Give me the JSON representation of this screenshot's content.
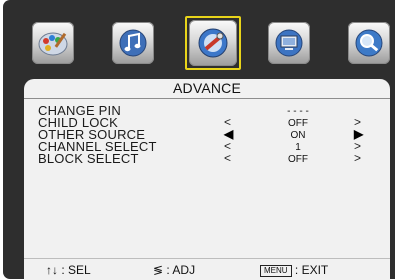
{
  "menu": {
    "tabs": [
      {
        "icon": "picture-palette-icon"
      },
      {
        "icon": "sound-note-icon"
      },
      {
        "icon": "advance-tools-icon",
        "selected": true
      },
      {
        "icon": "tv-setup-icon"
      },
      {
        "icon": "search-magnifier-icon"
      }
    ]
  },
  "panel": {
    "title": "ADVANCE",
    "rows": [
      {
        "label": "CHANGE PIN",
        "value": "- - - -",
        "arrows": false
      },
      {
        "label": "CHILD LOCK",
        "value": "OFF",
        "arrows": true
      },
      {
        "label": "OTHER SOURCE",
        "value": "ON",
        "arrows": true,
        "highlighted": true
      },
      {
        "label": "CHANNEL SELECT",
        "value": "1",
        "arrows": true
      },
      {
        "label": "BLOCK SELECT",
        "value": "OFF",
        "arrows": true
      }
    ]
  },
  "footer": {
    "sel_key": "↑↓",
    "sel_label": ": SEL",
    "adj_key": "≶",
    "adj_label": ": ADJ",
    "exit_key": "MENU",
    "exit_label": ": EXIT"
  },
  "colors": {
    "osd_background": "#2e2e2e",
    "panel_background": "#f1f1f1",
    "selection_border": "#e8d41a"
  }
}
